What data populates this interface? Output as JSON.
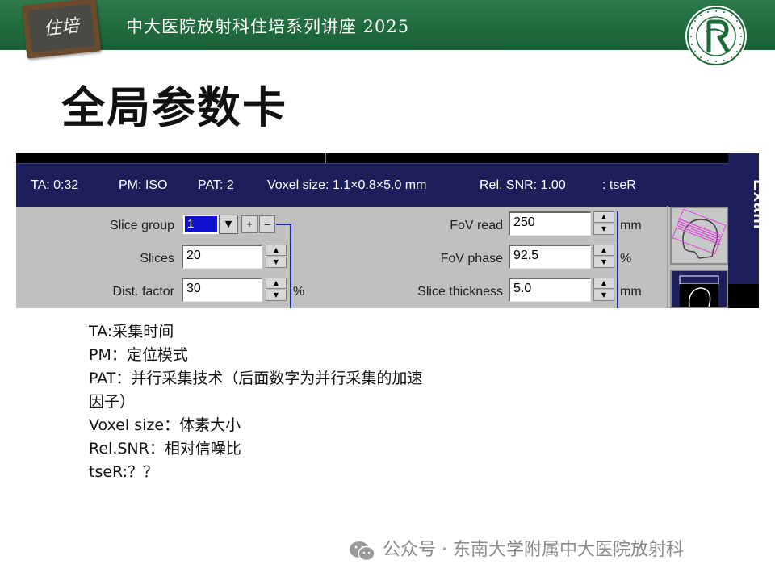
{
  "header": {
    "board_text": "住培",
    "title": "中大医院放射科住培系列讲座 2025",
    "colors": {
      "band": "#1f6a3d",
      "logo": "#1a6a3a"
    }
  },
  "slide": {
    "title": "全局参数卡"
  },
  "scanner": {
    "status": {
      "ta": "TA: 0:32",
      "pm": "PM: ISO",
      "pat": "PAT: 2",
      "voxel": "Voxel size: 1.1×0.8×5.0 mm",
      "snr": "Rel. SNR: 1.00",
      "seq": ": tseR"
    },
    "side_tab": "Exam",
    "left_params": [
      {
        "label": "Slice group",
        "value": "1"
      },
      {
        "label": "Slices",
        "value": "20"
      },
      {
        "label": "Dist. factor",
        "value": "30",
        "unit": "%"
      }
    ],
    "slice_group_buttons": {
      "add": "+",
      "remove": "–",
      "dropdown": "▼"
    },
    "right_params": [
      {
        "label": "FoV read",
        "value": "250",
        "unit": "mm"
      },
      {
        "label": "FoV phase",
        "value": "92.5",
        "unit": "%"
      },
      {
        "label": "Slice thickness",
        "value": "5.0",
        "unit": "mm"
      }
    ],
    "spinner": {
      "up": "▲",
      "down": "▼"
    },
    "colors": {
      "status_bg": "#1d1f5a",
      "panel_bg": "#c0c0c0",
      "selection": "#1010d0",
      "line": "#1c2a9a"
    }
  },
  "notes": [
    "TA:采集时间",
    "PM：定位模式",
    "PAT：并行采集技术（后面数字为并行采集的加速",
    "因子）",
    "Voxel size：体素大小",
    "Rel.SNR：相对信噪比",
    "tseR:？？"
  ],
  "watermark": {
    "text": "公众号 · 东南大学附属中大医院放射科",
    "icon": "wechat-icon"
  }
}
